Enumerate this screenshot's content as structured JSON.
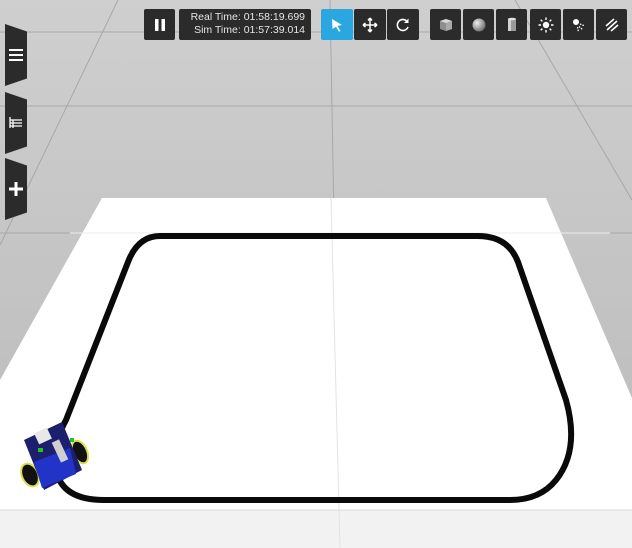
{
  "time": {
    "real_label": "Real Time:",
    "real_value": "01:58:19.699",
    "sim_label": "Sim Time:",
    "sim_value": "01:57:39.014"
  },
  "toolbar": {
    "play_pause_state": "paused",
    "active_tool": "select",
    "tools": [
      "select-icon",
      "translate-icon",
      "rotate-icon"
    ],
    "shapes": [
      "box-icon",
      "sphere-icon",
      "cylinder-icon"
    ],
    "lights": [
      "point-light-icon",
      "spot-light-icon",
      "directional-light-icon"
    ]
  },
  "side_panel": {
    "tabs": [
      "menu-icon",
      "tree-icon",
      "insert-icon"
    ]
  },
  "colors": {
    "accent": "#2aa7e0",
    "toolbar_bg": "#2b2b2b",
    "ground": "#bdbdbd",
    "track_plane": "#ffffff",
    "track_line": "#000000"
  }
}
